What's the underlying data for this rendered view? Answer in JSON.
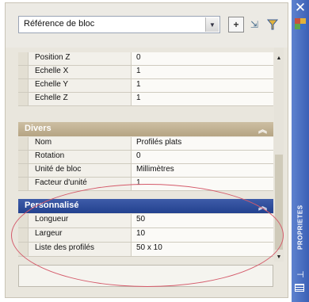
{
  "header": {
    "selection": "Référence de bloc"
  },
  "geometry_rows": [
    {
      "label": "Position Z",
      "value": "0"
    },
    {
      "label": "Echelle X",
      "value": "1"
    },
    {
      "label": "Echelle Y",
      "value": "1"
    },
    {
      "label": "Echelle Z",
      "value": "1"
    }
  ],
  "divers": {
    "title": "Divers",
    "rows": [
      {
        "label": "Nom",
        "value": "Profilés plats"
      },
      {
        "label": "Rotation",
        "value": "0"
      },
      {
        "label": "Unité de bloc",
        "value": "Millimètres"
      },
      {
        "label": "Facteur d'unité",
        "value": "1"
      }
    ]
  },
  "personnalise": {
    "title": "Personnalisé",
    "rows": [
      {
        "label": "Longueur",
        "value": "50"
      },
      {
        "label": "Largeur",
        "value": "10"
      },
      {
        "label": "Liste des profilés",
        "value": "50 x 10"
      }
    ]
  },
  "titlebar": {
    "title": "PROPRIETES"
  },
  "icons": {
    "close": "close-icon",
    "toggle_pickadd": "toggle-pickadd-icon",
    "select_objects": "select-objects-icon",
    "quick_select": "quick-select-icon",
    "properties": "properties-icon",
    "autohide": "autohide-icon",
    "menu": "properties-menu-icon"
  },
  "colors": {
    "category_divers": "#b5a483",
    "category_personnalise": "#23428f",
    "titlebar": "#3b60b5",
    "annotation_ellipse": "#d45a6a"
  }
}
